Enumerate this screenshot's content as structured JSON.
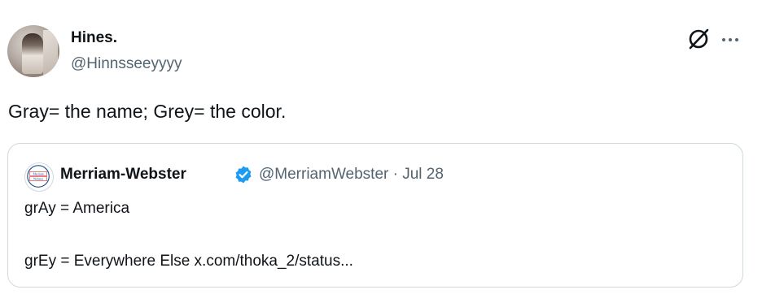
{
  "tweet": {
    "author": {
      "name": "Hines.",
      "handle": "@Hinnsseeyyyy"
    },
    "text": "Gray= the name; Grey= the color.",
    "icons": {
      "grok": "grok-icon",
      "more": "more-icon"
    }
  },
  "quoted_tweet": {
    "author": {
      "name": "Merriam-Webster",
      "handle": "@MerriamWebster",
      "separator": "·",
      "date": "Jul 28",
      "meta": "@MerriamWebster · Jul 28",
      "logo_text": [
        "Merriam",
        "Webster"
      ]
    },
    "verified_badge": "verified-icon",
    "lines": [
      "grAy = America",
      "grEy = Everywhere Else x.com/thoka_2/status..."
    ]
  },
  "colors": {
    "text_primary": "#0f1419",
    "text_secondary": "#536471",
    "border": "#cfd9de",
    "verified_blue": "#1d9bf0",
    "mw_red": "#d71920",
    "mw_blue": "#1f4e8c"
  }
}
